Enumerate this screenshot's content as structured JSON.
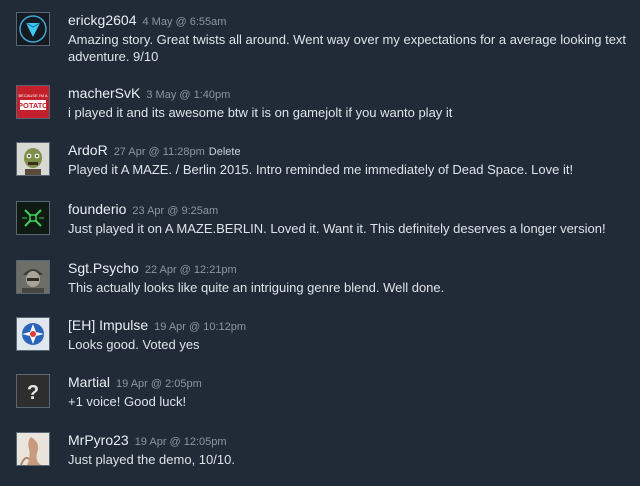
{
  "comments": [
    {
      "author": "erickg2604",
      "timestamp": "4 May @ 6:55am",
      "text": "Amazing story. Great twists all around. Went way over my expectations for a average looking text adventure. 9/10",
      "avatar": "blue-diamond-avatar"
    },
    {
      "author": "macherSvK",
      "timestamp": "3 May @ 1:40pm",
      "text": "i played it and its awesome btw it is on gamejolt if you wanto play it",
      "avatar": "potato-avatar",
      "avatar_text": [
        "BECAUSE I'M A",
        "POTATO"
      ]
    },
    {
      "author": "ArdoR",
      "timestamp": "27 Apr @ 11:28pm",
      "delete_label": "Delete",
      "text": "Played it A MAZE. / Berlin 2015. Intro reminded me immediately of Dead Space. Love it!",
      "avatar": "zombie-avatar"
    },
    {
      "author": "founderio",
      "timestamp": "23 Apr @ 9:25am",
      "text": "Just played it on A MAZE.BERLIN. Loved it. Want it. This definitely deserves a longer version!",
      "avatar": "green-glyph-avatar"
    },
    {
      "author": "Sgt.Psycho",
      "timestamp": "22 Apr @ 12:21pm",
      "text": "This actually looks like quite an intriguing genre blend. Well done.",
      "avatar": "soldier-avatar"
    },
    {
      "author": "[EH] Impulse",
      "timestamp": "19 Apr @ 10:12pm",
      "text": "Looks good. Voted yes",
      "avatar": "emblem-avatar"
    },
    {
      "author": "Martial",
      "timestamp": "19 Apr @ 2:05pm",
      "text": "+1 voice! Good luck!",
      "avatar": "question-mark-avatar",
      "avatar_text": [
        "?"
      ]
    },
    {
      "author": "MrPyro23",
      "timestamp": "19 Apr @ 12:05pm",
      "text": "Just played the demo, 10/10.",
      "avatar": "photo-avatar"
    }
  ]
}
